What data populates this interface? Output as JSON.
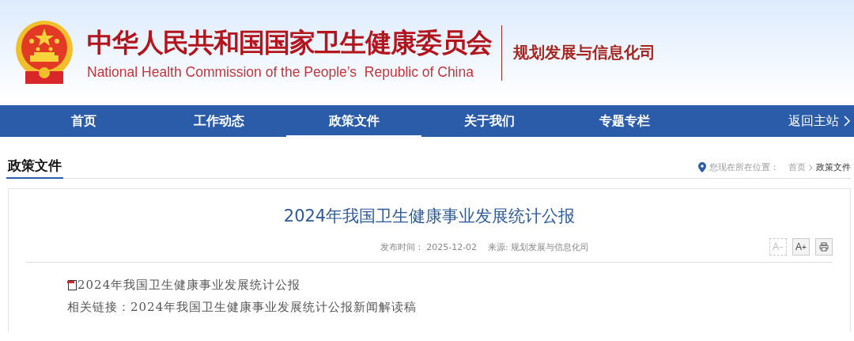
{
  "header": {
    "title_cn": "中华人民共和国国家卫生健康委员会",
    "title_en": "National Health Commission of the People’s  Republic of China",
    "department": "规划发展与信息化司"
  },
  "nav": {
    "items": [
      {
        "label": "首页",
        "selected": false
      },
      {
        "label": "工作动态",
        "selected": false
      },
      {
        "label": "政策文件",
        "selected": true
      },
      {
        "label": "关于我们",
        "selected": false
      },
      {
        "label": "专题专栏",
        "selected": false
      }
    ],
    "home_link": "返回主站"
  },
  "section": {
    "title": "政策文件",
    "location_label": "您现在所在位置：",
    "breadcrumb": [
      {
        "label": "首页"
      },
      {
        "label": "政策文件"
      }
    ]
  },
  "article": {
    "title": "2024年我国卫生健康事业发展统计公报",
    "published_label": "发布时间：",
    "published": "2025-12-02",
    "source": "来源: 规划发展与信息化司",
    "tools": [
      {
        "kind": "smaller",
        "label": "A",
        "sign": "−",
        "disabled": true
      },
      {
        "kind": "larger",
        "label": "A",
        "sign": "+",
        "disabled": false
      },
      {
        "kind": "print",
        "disabled": false
      }
    ],
    "attachment": "2024年我国卫生健康事业发展统计公报",
    "related": "相关链接：2024年我国卫生健康事业发展统计公报新闻解读稿"
  }
}
